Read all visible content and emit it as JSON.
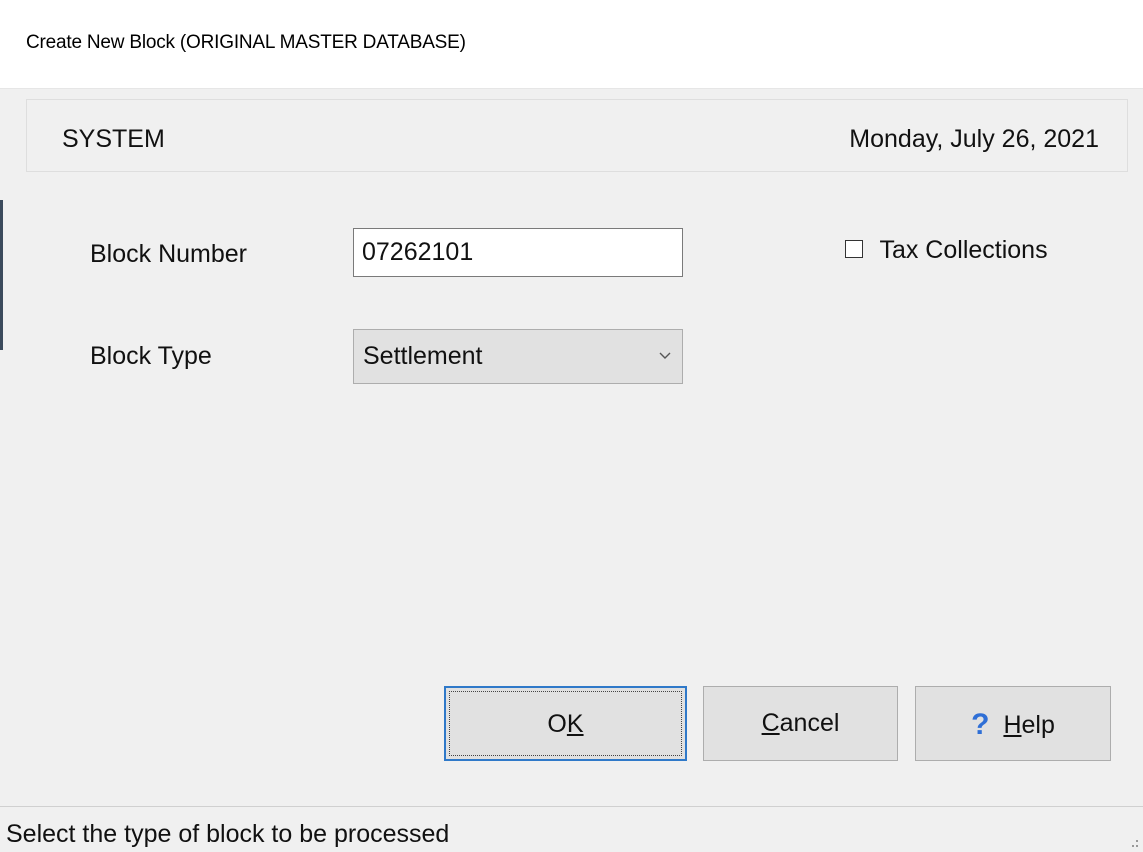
{
  "window": {
    "title": "Create New Block (ORIGINAL MASTER DATABASE)"
  },
  "header": {
    "system_label": "SYSTEM",
    "date": "Monday, July 26, 2021"
  },
  "form": {
    "block_number_label": "Block Number",
    "block_number_value": "07262101",
    "block_type_label": "Block Type",
    "block_type_value": "Settlement",
    "tax_collections_label": "Tax Collections",
    "tax_collections_checked": false
  },
  "buttons": {
    "ok": {
      "pre": "O",
      "accel": "K",
      "post": ""
    },
    "cancel": {
      "pre": "",
      "accel": "C",
      "post": "ancel"
    },
    "help": {
      "icon": "?",
      "pre": "",
      "accel": "H",
      "post": "elp"
    }
  },
  "status": {
    "text": "Select the type of block to be processed"
  },
  "icons": {
    "dropdown": "chevron-down-icon",
    "help": "help-question-icon",
    "grip": "size-grip-icon"
  },
  "colors": {
    "accent": "#2f79c9",
    "help_icon": "#2f6fd6",
    "panel": "#f0f0f0",
    "button": "#e1e1e1"
  }
}
